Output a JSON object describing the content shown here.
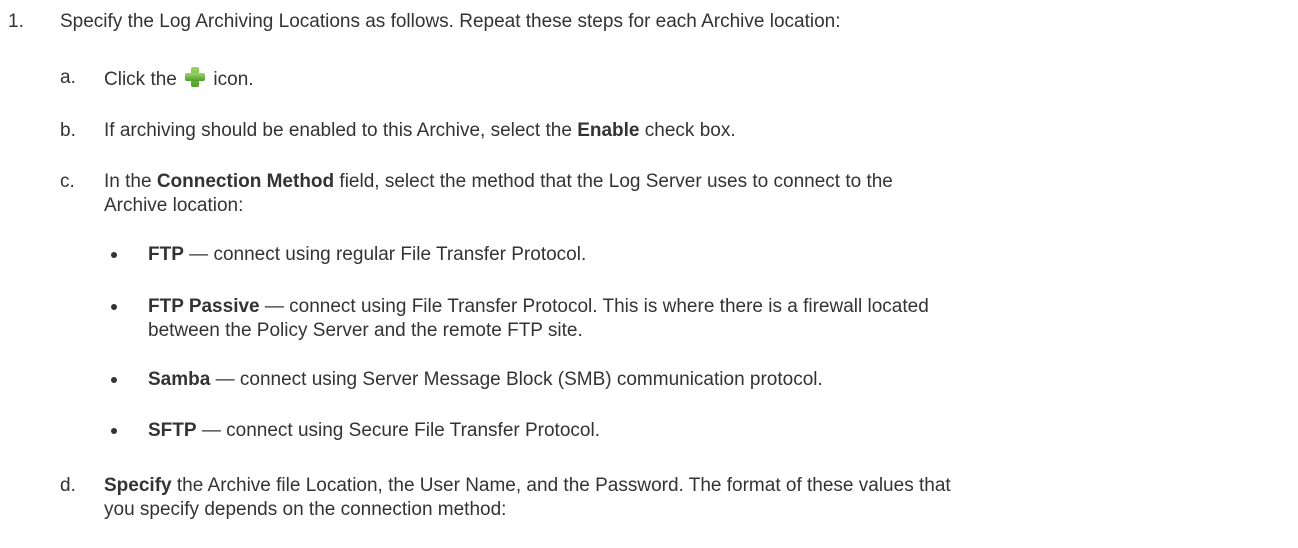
{
  "step": {
    "number": "1.",
    "text": "Specify the Log Archiving Locations as follows. Repeat these steps for each Archive location:"
  },
  "substeps": {
    "a": {
      "letter": "a.",
      "pre": "Click the",
      "post": "icon.",
      "icon": "green-plus-icon"
    },
    "b": {
      "letter": "b.",
      "pre": "If archiving should be enabled to this Archive, select the",
      "bold": "Enable",
      "post": "check box."
    },
    "c": {
      "letter": "c.",
      "pre": "In the",
      "bold": "Connection Method",
      "post": "field, select the method that the Log Server uses to connect to the",
      "line2": "Archive location:"
    },
    "d": {
      "letter": "d.",
      "bold": "Specify",
      "post": "the Archive file Location, the User Name, and the Password. The format of these values that",
      "line2": "you specify depends on the connection method:"
    }
  },
  "methods": [
    {
      "name": "FTP",
      "desc": "— connect using regular File Transfer Protocol."
    },
    {
      "name": "FTP Passive",
      "desc": "— connect using File Transfer Protocol. This is where there is a firewall located",
      "line2": "between the Policy Server and the remote FTP site."
    },
    {
      "name": "Samba",
      "desc": "— connect using Server Message Block (SMB) communication protocol."
    },
    {
      "name": "SFTP",
      "desc": "— connect using Secure File Transfer Protocol."
    }
  ]
}
